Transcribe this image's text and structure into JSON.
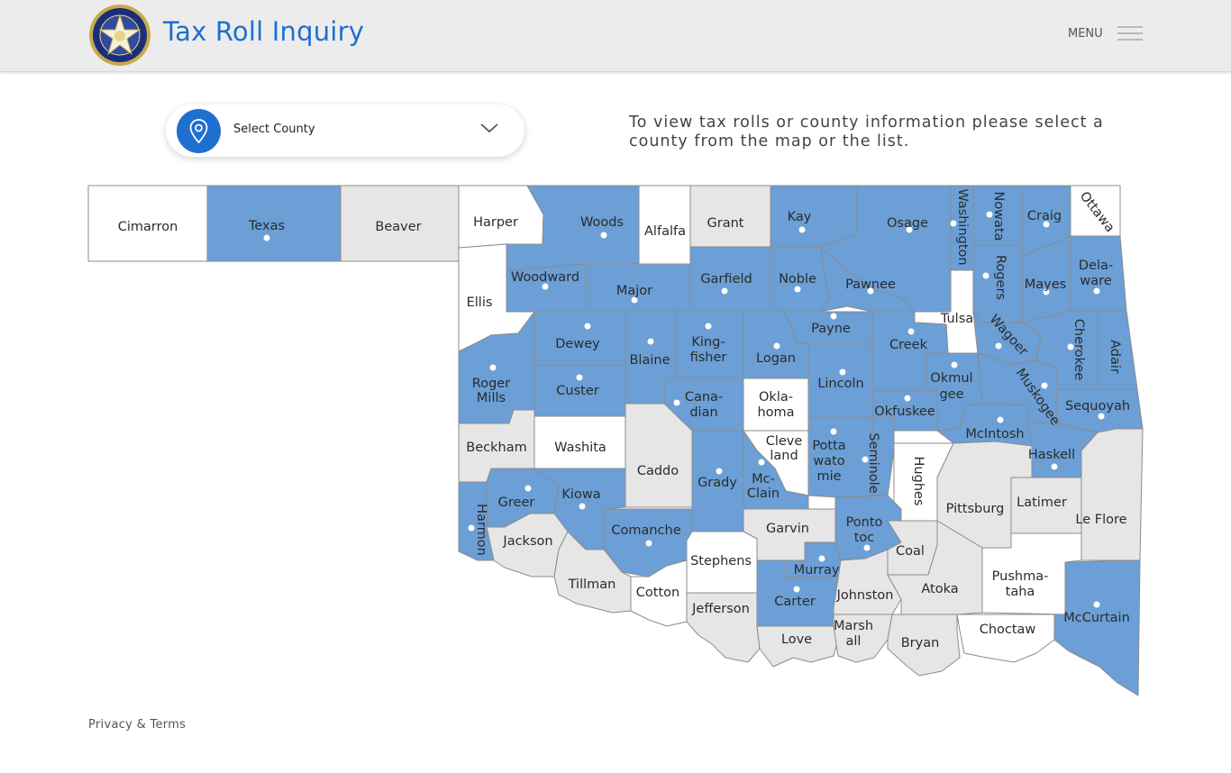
{
  "header": {
    "title": "Tax Roll Inquiry",
    "menu_label": "MENU",
    "seal_icon": "state-seal-icon"
  },
  "county_select": {
    "label": "Select County",
    "icon": "map-pin-icon"
  },
  "instructions": "To view tax rolls or county information please select a county from the map or the list.",
  "colors": {
    "brand_blue": "#1f6fd1",
    "county_active": "#6b9fd6",
    "county_gray": "#e6e6e6",
    "county_white": "#ffffff",
    "border": "#8c8c8c"
  },
  "map": {
    "counties": [
      {
        "name": "Cimarron",
        "status": "white"
      },
      {
        "name": "Texas",
        "status": "active"
      },
      {
        "name": "Beaver",
        "status": "gray"
      },
      {
        "name": "Harper",
        "status": "white"
      },
      {
        "name": "Woods",
        "status": "active"
      },
      {
        "name": "Alfalfa",
        "status": "white"
      },
      {
        "name": "Grant",
        "status": "gray"
      },
      {
        "name": "Kay",
        "status": "active"
      },
      {
        "name": "Osage",
        "status": "active"
      },
      {
        "name": "Washington",
        "status": "active"
      },
      {
        "name": "Nowata",
        "status": "active"
      },
      {
        "name": "Craig",
        "status": "active"
      },
      {
        "name": "Ottawa",
        "status": "white"
      },
      {
        "name": "Ellis",
        "status": "white"
      },
      {
        "name": "Woodward",
        "status": "active"
      },
      {
        "name": "Major",
        "status": "active"
      },
      {
        "name": "Garfield",
        "status": "active"
      },
      {
        "name": "Noble",
        "status": "active"
      },
      {
        "name": "Pawnee",
        "status": "active"
      },
      {
        "name": "Rogers",
        "status": "active"
      },
      {
        "name": "Mayes",
        "status": "active"
      },
      {
        "name": "Dela-",
        "status": "active"
      },
      {
        "name": "ware",
        "status": "active"
      },
      {
        "name": "Tulsa",
        "status": "white"
      },
      {
        "name": "Dewey",
        "status": "active"
      },
      {
        "name": "Blaine",
        "status": "active"
      },
      {
        "name": "King-",
        "status": "active"
      },
      {
        "name": "fisher",
        "status": "active"
      },
      {
        "name": "Logan",
        "status": "active"
      },
      {
        "name": "Payne",
        "status": "active"
      },
      {
        "name": "Creek",
        "status": "active"
      },
      {
        "name": "Wagoer",
        "status": "active"
      },
      {
        "name": "Cherokee",
        "status": "active"
      },
      {
        "name": "Adair",
        "status": "active"
      },
      {
        "name": "Roger",
        "status": "active"
      },
      {
        "name": "Mills",
        "status": "active"
      },
      {
        "name": "Custer",
        "status": "active"
      },
      {
        "name": "Cana-",
        "status": "active"
      },
      {
        "name": "dian",
        "status": "active"
      },
      {
        "name": "Okla-",
        "status": "white"
      },
      {
        "name": "homa",
        "status": "white"
      },
      {
        "name": "Lincoln",
        "status": "active"
      },
      {
        "name": "Okmul",
        "status": "active"
      },
      {
        "name": "gee",
        "status": "active"
      },
      {
        "name": "Muskogee",
        "status": "active"
      },
      {
        "name": "Sequoyah",
        "status": "active"
      },
      {
        "name": "Okfuskee",
        "status": "active"
      },
      {
        "name": "Beckham",
        "status": "gray"
      },
      {
        "name": "Washita",
        "status": "white"
      },
      {
        "name": "Caddo",
        "status": "gray"
      },
      {
        "name": "Cleve",
        "status": "white"
      },
      {
        "name": "land",
        "status": "white"
      },
      {
        "name": "Potta",
        "status": "active"
      },
      {
        "name": "wato",
        "status": "active"
      },
      {
        "name": "mie",
        "status": "active"
      },
      {
        "name": "Seminole",
        "status": "active"
      },
      {
        "name": "Hughes",
        "status": "white"
      },
      {
        "name": "McIntosh",
        "status": "active"
      },
      {
        "name": "Haskell",
        "status": "active"
      },
      {
        "name": "Grady",
        "status": "active"
      },
      {
        "name": "Mc-",
        "status": "active"
      },
      {
        "name": "Clain",
        "status": "active"
      },
      {
        "name": "Greer",
        "status": "active"
      },
      {
        "name": "Kiowa",
        "status": "active"
      },
      {
        "name": "Harmon",
        "status": "active"
      },
      {
        "name": "Pittsburg",
        "status": "gray"
      },
      {
        "name": "Latimer",
        "status": "gray"
      },
      {
        "name": "Le Flore",
        "status": "gray"
      },
      {
        "name": "Jackson",
        "status": "gray"
      },
      {
        "name": "Comanche",
        "status": "active"
      },
      {
        "name": "Garvin",
        "status": "gray"
      },
      {
        "name": "Ponto",
        "status": "active"
      },
      {
        "name": "toc",
        "status": "active"
      },
      {
        "name": "Coal",
        "status": "gray"
      },
      {
        "name": "Stephens",
        "status": "white"
      },
      {
        "name": "Murray",
        "status": "active"
      },
      {
        "name": "Tillman",
        "status": "gray"
      },
      {
        "name": "Cotton",
        "status": "white"
      },
      {
        "name": "Carter",
        "status": "active"
      },
      {
        "name": "Johnston",
        "status": "gray"
      },
      {
        "name": "Atoka",
        "status": "gray"
      },
      {
        "name": "Pushma-",
        "status": "white"
      },
      {
        "name": "taha",
        "status": "white"
      },
      {
        "name": "McCurtain",
        "status": "active"
      },
      {
        "name": "Jefferson",
        "status": "gray"
      },
      {
        "name": "Marsh",
        "status": "gray"
      },
      {
        "name": "all",
        "status": "gray"
      },
      {
        "name": "Bryan",
        "status": "gray"
      },
      {
        "name": "Choctaw",
        "status": "white"
      },
      {
        "name": "Love",
        "status": "gray"
      }
    ]
  },
  "footer": {
    "link": "Privacy & Terms"
  }
}
